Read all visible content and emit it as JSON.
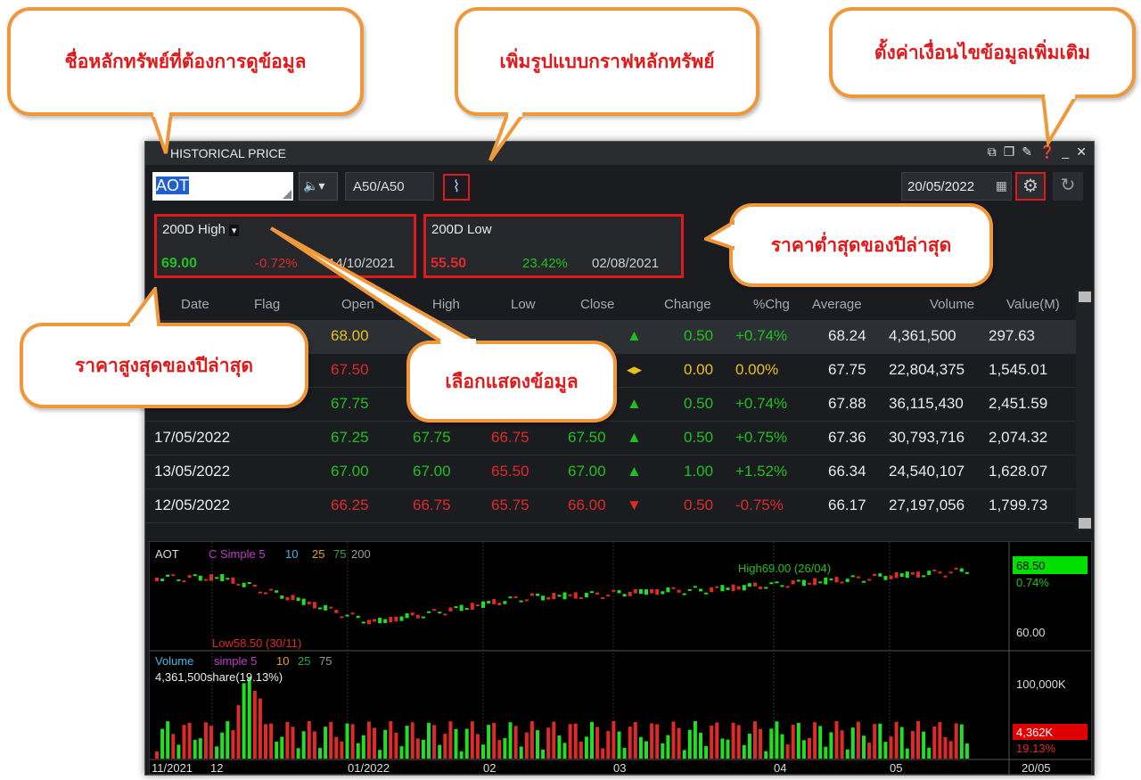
{
  "window": {
    "title": "HISTORICAL PRICE",
    "icons": [
      "external-link-icon",
      "restore-icon",
      "pin-icon",
      "help-icon",
      "minimize-icon",
      "close-icon"
    ]
  },
  "toolbar": {
    "symbol": "AOT",
    "market": "A50/A50",
    "date": "20/05/2022"
  },
  "high_box": {
    "label": "200D High",
    "value": "69.00",
    "pct": "-0.72%",
    "date": "14/10/2021"
  },
  "low_box": {
    "label": "200D Low",
    "value": "55.50",
    "pct": "23.42%",
    "date": "02/08/2021"
  },
  "table": {
    "headers": [
      "Date",
      "Flag",
      "Open",
      "High",
      "Low",
      "Close",
      "Change",
      "%Chg",
      "Average",
      "Volume",
      "Value(M)"
    ],
    "rows": [
      {
        "date": "",
        "open": "68.00",
        "high": "",
        "low": "",
        "close": "",
        "dir": "▲",
        "change": "0.50",
        "pchg": "+0.74%",
        "avg": "68.24",
        "volume": "4,361,500",
        "value": "297.63"
      },
      {
        "date": "",
        "open": "67.50",
        "high": "",
        "low": "",
        "close": "",
        "dir": "◂▸",
        "change": "0.00",
        "pchg": "0.00%",
        "avg": "67.75",
        "volume": "22,804,375",
        "value": "1,545.01"
      },
      {
        "date": "",
        "open": "67.75",
        "high": "",
        "low": "",
        "close": "",
        "dir": "▲",
        "change": "0.50",
        "pchg": "+0.74%",
        "avg": "67.88",
        "volume": "36,115,430",
        "value": "2,451.59"
      },
      {
        "date": "17/05/2022",
        "open": "67.25",
        "high": "67.75",
        "low": "66.75",
        "close": "67.50",
        "dir": "▲",
        "change": "0.50",
        "pchg": "+0.75%",
        "avg": "67.36",
        "volume": "30,793,716",
        "value": "2,074.32"
      },
      {
        "date": "13/05/2022",
        "open": "67.00",
        "high": "67.00",
        "low": "65.50",
        "close": "67.00",
        "dir": "▲",
        "change": "1.00",
        "pchg": "+1.52%",
        "avg": "66.34",
        "volume": "24,540,107",
        "value": "1,628.07"
      },
      {
        "date": "12/05/2022",
        "open": "66.25",
        "high": "66.75",
        "low": "65.75",
        "close": "66.00",
        "dir": "▼",
        "change": "0.50",
        "pchg": "-0.75%",
        "avg": "66.17",
        "volume": "27,197,056",
        "value": "1,799.73"
      }
    ]
  },
  "chart": {
    "price_legend": {
      "symbol": "AOT",
      "ma": "C Simple 5",
      "p2": "10",
      "p3": "25",
      "p4": "75",
      "p5": "200"
    },
    "high_note": "High69.00 (26/04)",
    "low_note": "Low58.50 (30/11)",
    "last_price": "68.50",
    "last_pct": "0.74%",
    "price_tick": "60.00",
    "volume_legend": {
      "name": "Volume",
      "ma": "simple 5",
      "p2": "10",
      "p3": "25",
      "p4": "75"
    },
    "volume_note": "4,361,500share(19.13%)",
    "vol_tick": "100,000K",
    "vol_last": "4,362K",
    "vol_pct": "19.13%",
    "x_ticks": [
      "11/2021",
      "12",
      "01/2022",
      "02",
      "03",
      "04",
      "05",
      "20/05"
    ]
  },
  "callouts": {
    "symbol": "ชื่อหลักทรัพย์ที่ต้องการดูข้อมูล",
    "chart": "เพิ่มรูปแบบกราฟหลักทรัพย์",
    "settings": "ตั้งค่าเงื่อนไขข้อมูลเพิ่มเติม",
    "low": "ราคาต่ำสุดของปีล่าสุด",
    "high": "ราคาสูงสุดของปีล่าสุด",
    "select": "เลือกแสดงข้อมูล"
  },
  "colors": {
    "accent_red": "#e0191b",
    "callout_border": "#f0973a",
    "up": "#21c021",
    "down": "#e02a2a"
  }
}
